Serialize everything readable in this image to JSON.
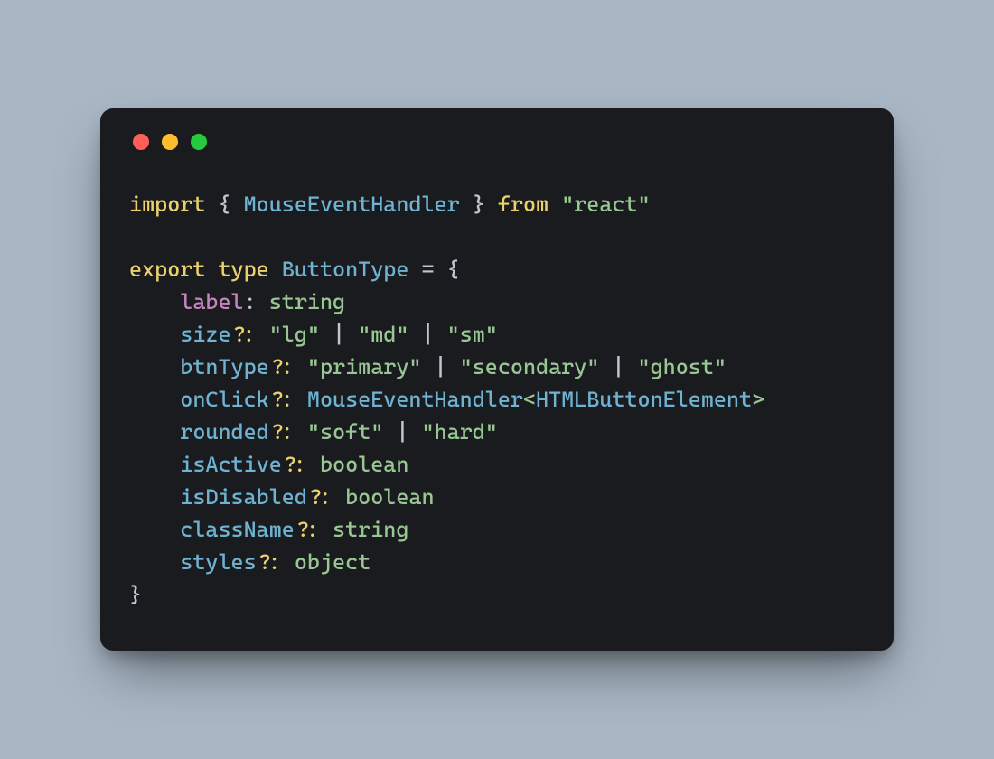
{
  "colors": {
    "bg": "#a9b7c5",
    "window": "#1a1b1f",
    "red": "#ff5f56",
    "yellow": "#ffbd2e",
    "green": "#27c93f",
    "keyword": "#e9d16c",
    "ident": "#6fb3d2",
    "string": "#99c794",
    "prop": "#c586c0"
  },
  "code": {
    "kw_import": "import",
    "brace_open": "{",
    "ident_mouse": "MouseEventHandler",
    "brace_close": "}",
    "kw_from": "from",
    "str_react": "\"react\"",
    "kw_export": "export",
    "kw_type": "type",
    "ident_btype": "ButtonType",
    "eq": "=",
    "obj_open": "{",
    "prop_label": "label",
    "colon": ":",
    "t_string": "string",
    "prop_size": "size",
    "opt": "?",
    "s_lg": "\"lg\"",
    "pipe": "|",
    "s_md": "\"md\"",
    "s_sm": "\"sm\"",
    "prop_btntype": "btnType",
    "s_primary": "\"primary\"",
    "s_secondary": "\"secondary\"",
    "s_ghost": "\"ghost\"",
    "prop_onclick": "onClick",
    "lt": "<",
    "ident_htmlbtn": "HTMLButtonElement",
    "gt": ">",
    "prop_rounded": "rounded",
    "s_soft": "\"soft\"",
    "s_hard": "\"hard\"",
    "prop_isactive": "isActive",
    "t_boolean": "boolean",
    "prop_isdisabled": "isDisabled",
    "prop_classname": "className",
    "prop_styles": "styles",
    "t_object": "object",
    "obj_close": "}"
  }
}
